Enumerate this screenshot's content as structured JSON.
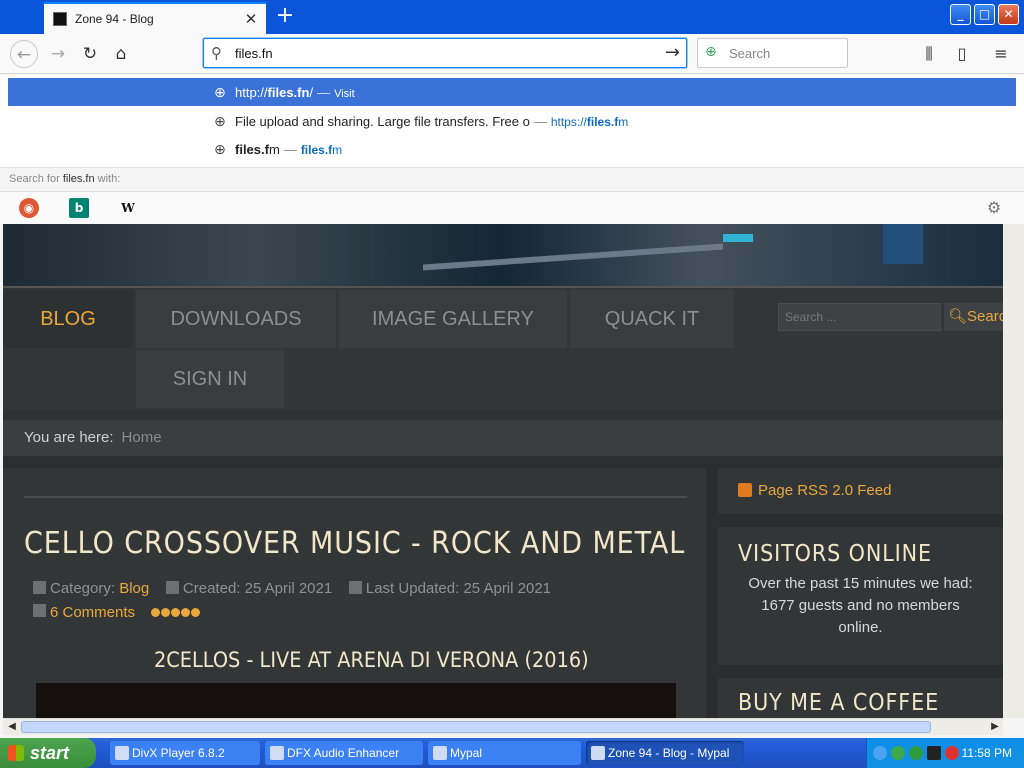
{
  "browser": {
    "tab_title": "Zone 94 - Blog",
    "url_value": "files.fn",
    "search_placeholder": "Search",
    "autocomplete": [
      {
        "prefix": "http://",
        "bold": "files.fn",
        "suffix": "/",
        "action": "Visit"
      },
      {
        "title": "File upload and sharing. Large file transfers. Free o",
        "url_prefix": "https://",
        "url_bold": "files.f",
        "url_suffix": "m"
      },
      {
        "bold": "files.f",
        "suffix": "m",
        "url_bold": "files.f",
        "url_suffix": "m"
      }
    ],
    "search_for": {
      "prefix": "Search for",
      "query": "files.fn",
      "suffix": "with:"
    },
    "engines": [
      "DuckDuckGo",
      "Bing",
      "W"
    ]
  },
  "site": {
    "menu": [
      "BLOG",
      "DOWNLOADS",
      "IMAGE GALLERY",
      "QUACK IT",
      "SIGN IN"
    ],
    "search_placeholder": "Search ...",
    "search_button": "Search",
    "breadcrumb_label": "You are here:",
    "breadcrumb_home": "Home",
    "article": {
      "title": "CELLO CROSSOVER MUSIC - ROCK AND METAL",
      "category_label": "Category:",
      "category": "Blog",
      "created": "Created: 25 April 2021",
      "updated": "Last Updated: 25 April 2021",
      "comments": "6 Comments",
      "subtitle": "2CELLOS - LIVE AT ARENA DI VERONA (2016)"
    },
    "sidebar": {
      "rss": "Page RSS 2.0 Feed",
      "visitors_title": "VISITORS ONLINE",
      "visitors_text": "Over the past 15 minutes we had: 1677 guests and no members online.",
      "coffee_title": "BUY ME A COFFEE"
    }
  },
  "taskbar": {
    "start": "start",
    "tasks": [
      "DivX Player 6.8.2",
      "DFX Audio Enhancer",
      "Mypal",
      "Zone 94 - Blog - Mypal"
    ],
    "clock": "11:58 PM"
  }
}
